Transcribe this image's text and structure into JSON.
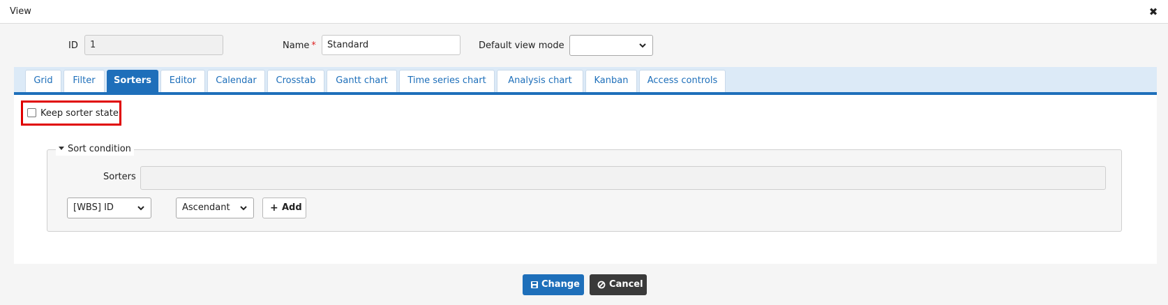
{
  "window": {
    "title": "View",
    "close_icon": "close-icon"
  },
  "fields": {
    "id_label": "ID",
    "id_value": "1",
    "name_label": "Name",
    "name_required_mark": "*",
    "name_value": "Standard",
    "default_view_mode_label": "Default view mode",
    "default_view_mode_value": ""
  },
  "tabs": [
    {
      "label": "Grid"
    },
    {
      "label": "Filter"
    },
    {
      "label": "Sorters",
      "active": true
    },
    {
      "label": "Editor"
    },
    {
      "label": "Calendar"
    },
    {
      "label": "Crosstab"
    },
    {
      "label": "Gantt chart"
    },
    {
      "label": "Time series chart"
    },
    {
      "label": "Analysis chart"
    },
    {
      "label": "Kanban"
    },
    {
      "label": "Access controls"
    }
  ],
  "sorters_tab": {
    "keep_state_label": "Keep sorter state",
    "keep_state_checked": false,
    "sort_condition": {
      "legend": "Sort condition",
      "sorters_label": "Sorters",
      "sorters_value": "",
      "column_select_value": "[WBS] ID",
      "direction_select_value": "Ascendant",
      "add_button_label": "Add"
    }
  },
  "footer": {
    "change_label": "Change",
    "cancel_label": "Cancel"
  },
  "colors": {
    "accent": "#1e6fba",
    "highlight": "#e00000",
    "cancel": "#3a3a3a"
  }
}
